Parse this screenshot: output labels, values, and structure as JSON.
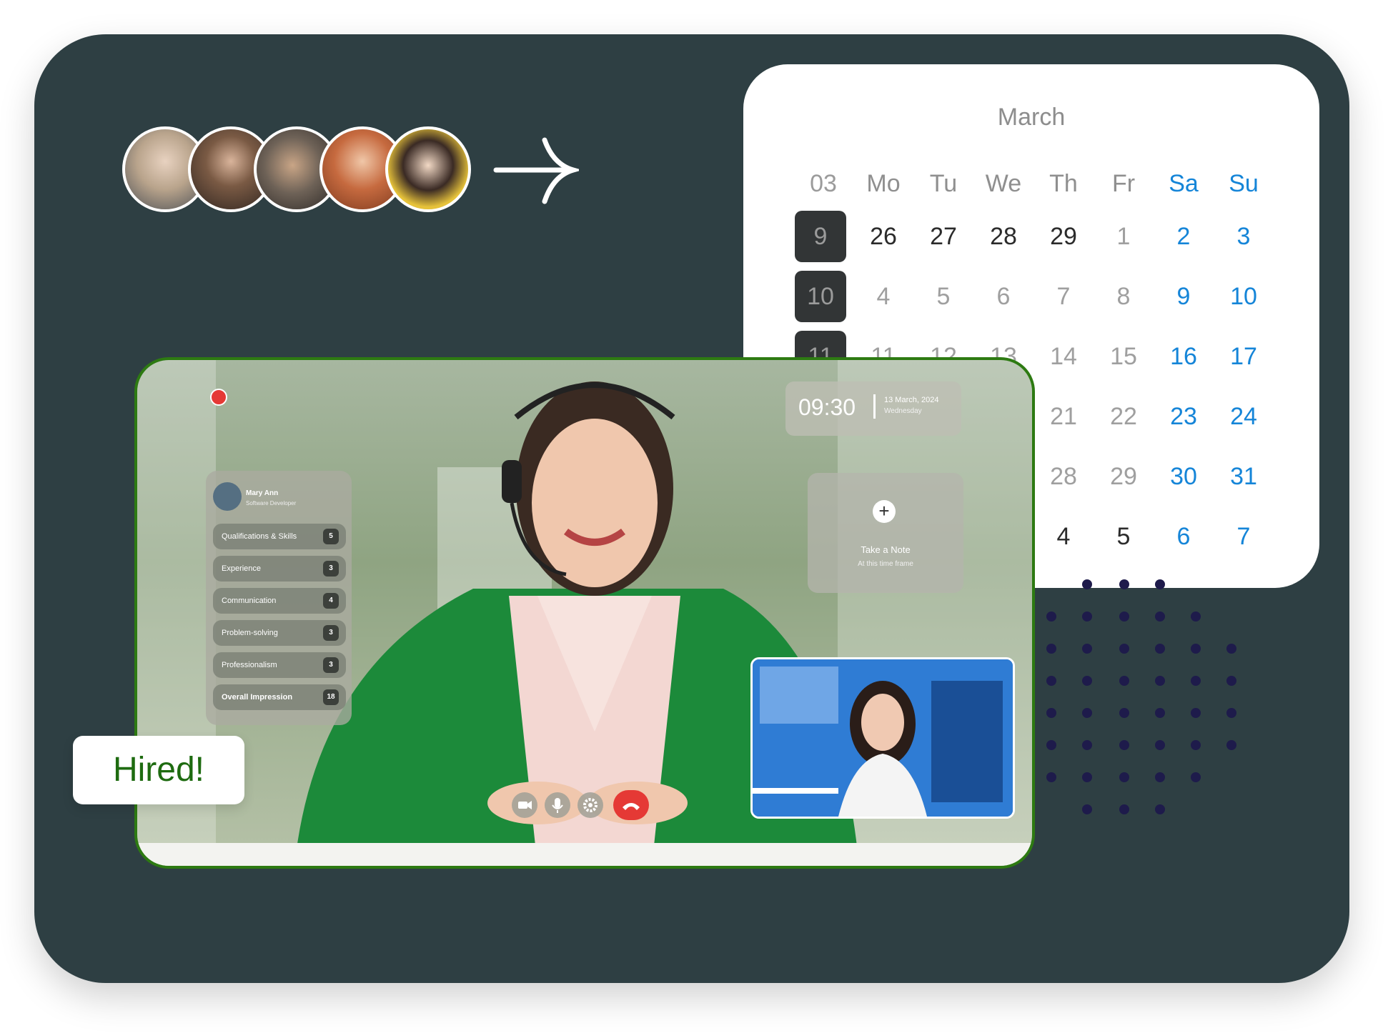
{
  "avatars": [
    {
      "name": "avatar-1",
      "color": "#b9a48c"
    },
    {
      "name": "avatar-2",
      "color": "#5a4233"
    },
    {
      "name": "avatar-3",
      "color": "#6e6257"
    },
    {
      "name": "avatar-4",
      "color": "#c66a3f"
    },
    {
      "name": "avatar-5",
      "color": "#e6c23a"
    }
  ],
  "calendar": {
    "month": "March",
    "week_header": "03",
    "day_headers": [
      "Mo",
      "Tu",
      "We",
      "Th",
      "Fr",
      "Sa",
      "Su"
    ],
    "week_numbers": [
      "9",
      "10",
      "11"
    ],
    "rows": [
      [
        "26",
        "27",
        "28",
        "29",
        "1",
        "2",
        "3"
      ],
      [
        "4",
        "5",
        "6",
        "7",
        "8",
        "9",
        "10"
      ],
      [
        "11",
        "12",
        "13",
        "14",
        "15",
        "16",
        "17"
      ],
      [
        "",
        "",
        "",
        "21",
        "22",
        "23",
        "24"
      ],
      [
        "",
        "",
        "",
        "28",
        "29",
        "30",
        "31"
      ],
      [
        "",
        "",
        "",
        "4",
        "5",
        "6",
        "7"
      ]
    ]
  },
  "video": {
    "time": "09:30",
    "date": "13 March, 2024",
    "weekday": "Wednesday",
    "note_title": "Take a Note",
    "note_sub": "At this time frame",
    "note_icon": "plus-icon",
    "candidate": {
      "name": "Mary Ann",
      "role": "Software Developer"
    },
    "criteria": [
      {
        "label": "Qualifications & Skills",
        "score": "5"
      },
      {
        "label": "Experience",
        "score": "3"
      },
      {
        "label": "Communication",
        "score": "4"
      },
      {
        "label": "Problem-solving",
        "score": "3"
      },
      {
        "label": "Professionalism",
        "score": "3"
      },
      {
        "label": "Overall Impression",
        "score": "18"
      }
    ],
    "controls": [
      "camera-icon",
      "microphone-icon",
      "gear-icon",
      "end-call-icon"
    ]
  },
  "badge": {
    "text": "Hired!"
  },
  "colors": {
    "background": "#2e3f43",
    "accent": "#1585d8",
    "brand_green": "#1e6b10",
    "end_call": "#e53935"
  }
}
